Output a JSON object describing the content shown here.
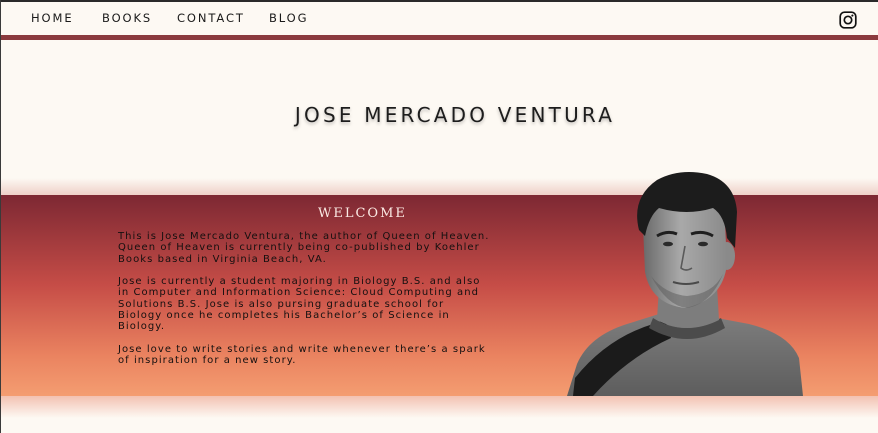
{
  "nav": {
    "items": [
      {
        "label": "HOME"
      },
      {
        "label": "BOOKS"
      },
      {
        "label": "CONTACT"
      },
      {
        "label": "BLOG"
      }
    ],
    "social_icon": "instagram-icon"
  },
  "header": {
    "title": "JOSE MERCADO VENTURA"
  },
  "welcome": {
    "heading": "WELCOME",
    "paragraphs": [
      "This is Jose Mercado Ventura, the author of Queen of Heaven.\nQueen of Heaven is currently  being co-published by Koehler\nBooks based in Virginia Beach, VA.",
      "Jose is currently a student majoring in Biology B.S. and also\nin Computer and Information Science: Cloud Computing and\nSolutions B.S. Jose is also pursing graduate school for\nBiology once he completes his Bachelor’s of Science in\nBiology.",
      "Jose love to write stories and write whenever there’s a spark\nof inspiration for a new story."
    ]
  },
  "colors": {
    "background": "#fdf9f3",
    "accent_bar": "#8b3a3e",
    "band_top": "#7d2833",
    "band_bottom": "#f49d71"
  }
}
